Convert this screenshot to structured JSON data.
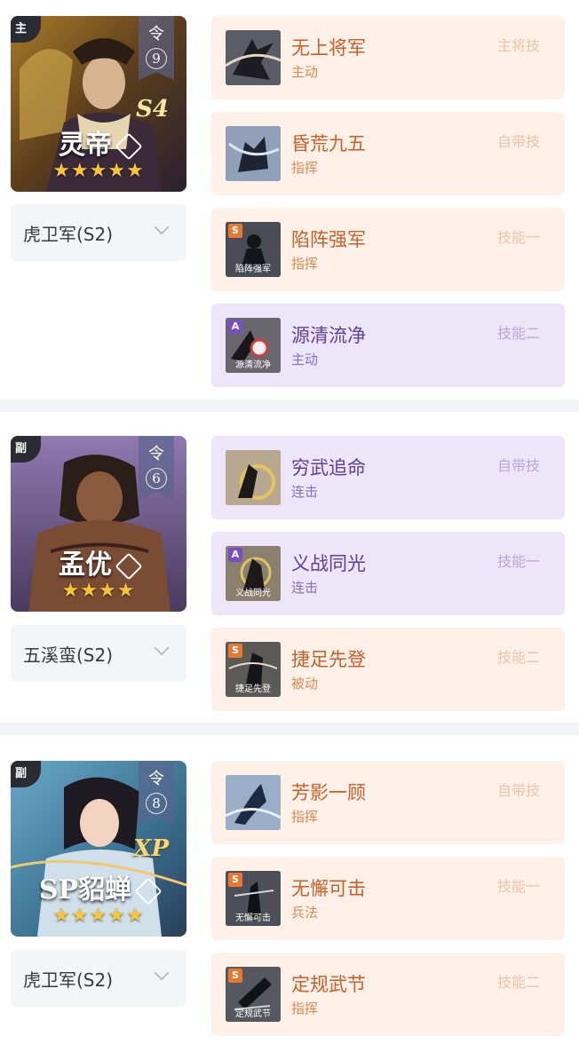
{
  "colors": {
    "orange_card": "#fff1e8",
    "purple_card": "#ede6f8",
    "divider": "#f2f3f5",
    "star": "#f7c637"
  },
  "heroes": [
    {
      "role": "主",
      "rank_label": "令",
      "rank_value": "9",
      "season_mark": "S4",
      "name": "灵帝",
      "stars": "★★★★★",
      "troop": "虎卫军(S2)",
      "skills": [
        {
          "name": "无上将军",
          "type": "主动",
          "slot": "主将技",
          "grade": "",
          "caption": "",
          "tone": "orange"
        },
        {
          "name": "昏荒九五",
          "type": "指挥",
          "slot": "自带技",
          "grade": "",
          "caption": "",
          "tone": "orange"
        },
        {
          "name": "陷阵强军",
          "type": "指挥",
          "slot": "技能一",
          "grade": "S",
          "caption": "陷阵强军",
          "tone": "orange"
        },
        {
          "name": "源清流净",
          "type": "主动",
          "slot": "技能二",
          "grade": "A",
          "caption": "源清流净",
          "tone": "purple"
        }
      ]
    },
    {
      "role": "副",
      "rank_label": "令",
      "rank_value": "6",
      "season_mark": "",
      "name": "孟优",
      "stars": "★★★★",
      "troop": "五溪蛮(S2)",
      "skills": [
        {
          "name": "穷武追命",
          "type": "连击",
          "slot": "自带技",
          "grade": "",
          "caption": "",
          "tone": "purple"
        },
        {
          "name": "义战同光",
          "type": "连击",
          "slot": "技能一",
          "grade": "A",
          "caption": "义战同光",
          "tone": "purple"
        },
        {
          "name": "捷足先登",
          "type": "被动",
          "slot": "技能二",
          "grade": "S",
          "caption": "捷足先登",
          "tone": "orange"
        }
      ]
    },
    {
      "role": "副",
      "rank_label": "令",
      "rank_value": "8",
      "season_mark": "XP",
      "name": "SP貂蝉",
      "stars": "★★★★★",
      "troop": "虎卫军(S2)",
      "skills": [
        {
          "name": "芳影一顾",
          "type": "指挥",
          "slot": "自带技",
          "grade": "",
          "caption": "",
          "tone": "orange"
        },
        {
          "name": "无懈可击",
          "type": "兵法",
          "slot": "技能一",
          "grade": "S",
          "caption": "无懈可击",
          "tone": "orange"
        },
        {
          "name": "定规武节",
          "type": "指挥",
          "slot": "技能二",
          "grade": "S",
          "caption": "定规武节",
          "tone": "orange"
        }
      ]
    }
  ]
}
